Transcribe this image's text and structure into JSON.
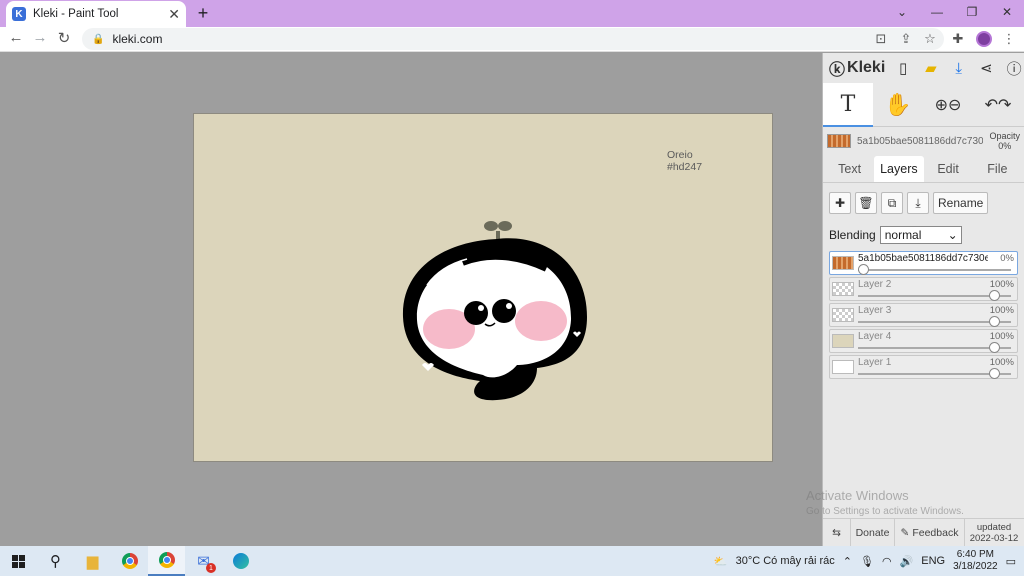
{
  "browser": {
    "tab_title": "Kleki - Paint Tool",
    "tab_favicon": "K",
    "tab_close": "✕",
    "new_tab": "+",
    "url": "kleki.com",
    "window_controls": {
      "dropdown": "⌄",
      "minimize": "—",
      "restore": "❐",
      "close": "✕"
    }
  },
  "canvas": {
    "signature_line1": "Oreio",
    "signature_line2": "#hd247",
    "background_color": "#dcd5bb"
  },
  "panel": {
    "brand": "Kleki",
    "brush_name": "5a1b05bae5081186dd7c730e",
    "opacity_label": "Opacity",
    "opacity_value": "0%",
    "tabs": [
      "Text",
      "Layers",
      "Edit",
      "File"
    ],
    "active_tab": "Layers",
    "rename_label": "Rename",
    "blending_label": "Blending",
    "blending_value": "normal",
    "layers": [
      {
        "name": "5a1b05bae5081186dd7c730e",
        "opacity": "0%",
        "opacity_fraction": 0.0,
        "active": true
      },
      {
        "name": "Layer 2",
        "opacity": "100%",
        "opacity_fraction": 1.0,
        "active": false
      },
      {
        "name": "Layer 3",
        "opacity": "100%",
        "opacity_fraction": 1.0,
        "active": false
      },
      {
        "name": "Layer 4",
        "opacity": "100%",
        "opacity_fraction": 1.0,
        "active": false
      },
      {
        "name": "Layer 1",
        "opacity": "100%",
        "opacity_fraction": 1.0,
        "active": false
      }
    ],
    "footer": {
      "donate": "Donate",
      "feedback": "Feedback",
      "updated_label": "updated",
      "updated_date": "2022-03-12"
    }
  },
  "watermark": {
    "title": "Activate Windows",
    "subtitle": "Go to Settings to activate Windows."
  },
  "taskbar": {
    "weather": "30°C  Có mây rải rác",
    "language": "ENG",
    "time": "6:40 PM",
    "date": "3/18/2022",
    "mail_badge": "1"
  }
}
